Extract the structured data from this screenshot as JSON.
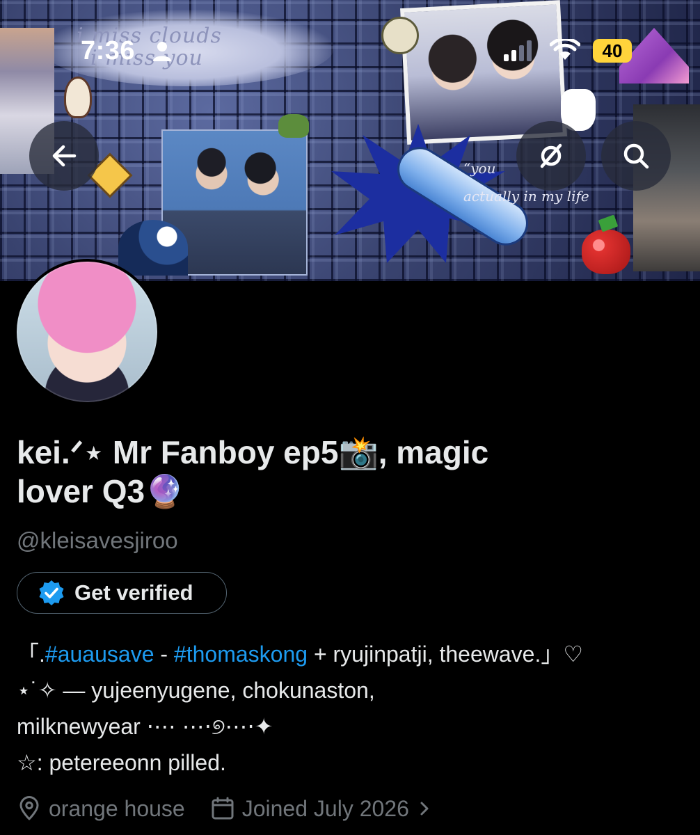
{
  "status_bar": {
    "time": "7:36",
    "battery": "40",
    "battery_color": "#ffd43b"
  },
  "header": {
    "back_icon": "arrow-left-icon",
    "hide_icon": "eye-off-icon",
    "search_icon": "search-icon"
  },
  "banner": {
    "cloud_text_line1": "i miss clouds",
    "cloud_text_line2": "i miss you",
    "quote_line1": "“you",
    "quote_line2": "actually in my life"
  },
  "profile": {
    "name_line1": "kei.ᐟ⋆ Mr Fanboy ep5📸, magic",
    "name_line2": "lover Q3🔮",
    "username": "@kleisavesjiroo",
    "verify_label": "Get verified",
    "verify_color": "#1d9bf0"
  },
  "bio": {
    "line1_prefix": "「.",
    "hashtag1": "#auausave",
    "line1_sep": " - ",
    "hashtag2": "#thomaskong",
    "line1_suffix": " + ryujinpatji, theewave.」♡",
    "line2": " ⋆˙✧ — yujeenyugene, chokunaston,",
    "line3": "milknewyear ⋅⋯ ⋯⋅୭⋯⋅✦",
    "line4": "☆: petereeonn pilled."
  },
  "meta": {
    "location": "orange house",
    "joined": "Joined July 2026",
    "location_icon": "location-pin-icon",
    "calendar_icon": "calendar-icon"
  },
  "colors": {
    "background": "#000000",
    "text": "#e7e9ea",
    "muted": "#71767b",
    "link": "#1d9bf0"
  }
}
